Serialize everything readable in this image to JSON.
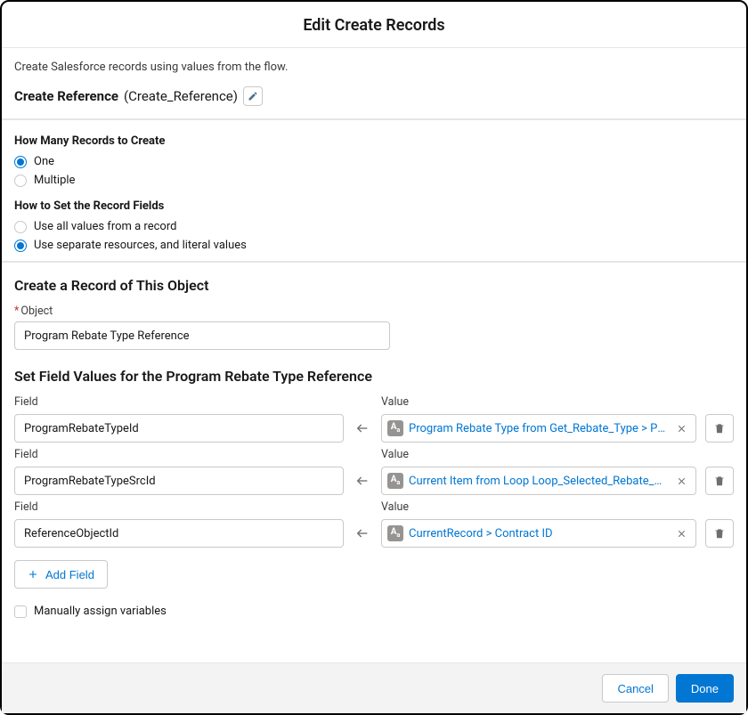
{
  "header": {
    "title": "Edit Create Records"
  },
  "intro": {
    "description": "Create Salesforce records using values from the flow.",
    "name_label": "Create Reference",
    "api_name": "(Create_Reference)"
  },
  "howMany": {
    "question": "How Many Records to Create",
    "options": [
      "One",
      "Multiple"
    ],
    "selected": 0
  },
  "howSet": {
    "question": "How to Set the Record Fields",
    "options": [
      "Use all values from a record",
      "Use separate resources, and literal values"
    ],
    "selected": 1
  },
  "createObject": {
    "section_title": "Create a Record of This Object",
    "label": "Object",
    "value": "Program Rebate Type Reference"
  },
  "setFields": {
    "section_title": "Set Field Values for the Program Rebate Type Reference",
    "field_label": "Field",
    "value_label": "Value",
    "rows": [
      {
        "field": "ProgramRebateTypeId",
        "value": "Program Rebate Type from Get_Rebate_Type > Pro…"
      },
      {
        "field": "ProgramRebateTypeSrcId",
        "value": "Current Item from Loop Loop_Selected_Rebate_Ty…"
      },
      {
        "field": "ReferenceObjectId",
        "value": "CurrentRecord > Contract ID"
      }
    ],
    "add_label": "Add Field",
    "checkbox_label": "Manually assign variables"
  },
  "footer": {
    "cancel": "Cancel",
    "done": "Done"
  }
}
